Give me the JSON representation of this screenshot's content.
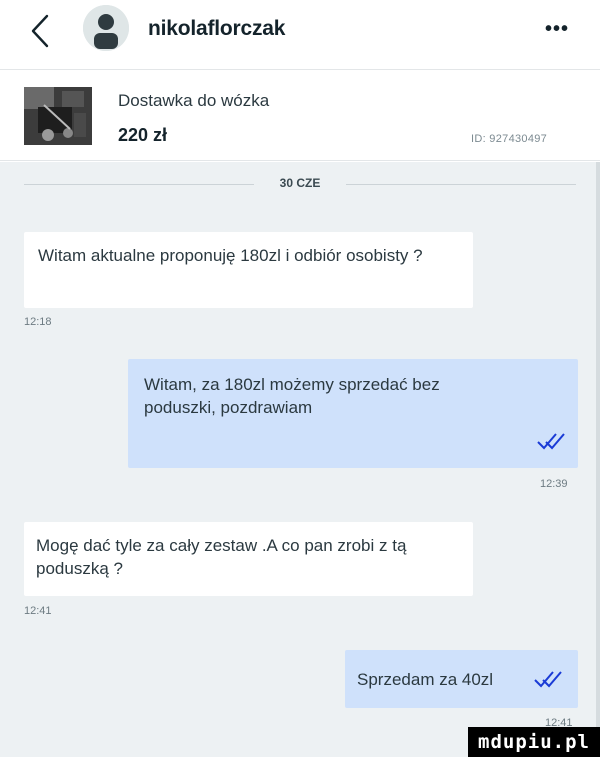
{
  "header": {
    "username": "nikolaflorczak",
    "more_label": "•••"
  },
  "product": {
    "title": "Dostawka do wózka",
    "price": "220 zł",
    "id_label": "ID: 927430497"
  },
  "chat": {
    "date_separator": "30 CZE",
    "messages": [
      {
        "direction": "incoming",
        "text": "Witam aktualne proponuję 180zl i odbiór osobisty ?",
        "time": "12:18"
      },
      {
        "direction": "outgoing",
        "text": "Witam, za 180zl możemy sprzedać bez poduszki, pozdrawiam",
        "time": "12:39",
        "read": true
      },
      {
        "direction": "incoming",
        "text": "Mogę dać tyle za cały zestaw .A co pan zrobi z tą poduszką ?",
        "time": "12:41"
      },
      {
        "direction": "outgoing",
        "text": "Sprzedam za 40zl",
        "time": "12:41",
        "read": true
      }
    ]
  },
  "watermark": "mdupiu.pl",
  "colors": {
    "chat_background": "#edf1f3",
    "incoming_bubble": "#ffffff",
    "outgoing_bubble": "#cfe1fb",
    "read_ticks": "#1a3bd6",
    "text": "#2b3940"
  },
  "icons": {
    "back": "chevron-left-icon",
    "more": "more-dots-icon",
    "read": "double-check-icon"
  }
}
